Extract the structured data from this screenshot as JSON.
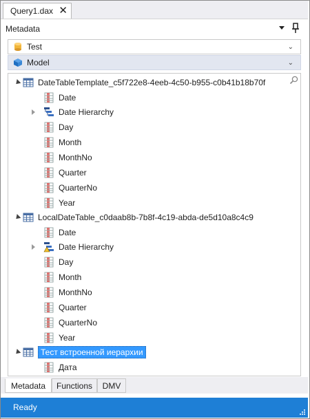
{
  "document_tab": {
    "title": "Query1.dax",
    "close_glyph": "✕"
  },
  "panel": {
    "title": "Metadata"
  },
  "database_combo": {
    "value": "Test",
    "icon": "database-icon"
  },
  "model_combo": {
    "value": "Model",
    "icon": "cube-icon"
  },
  "tree": {
    "tables": [
      {
        "name": "DateTableTemplate_c5f722e8-4eeb-4c50-b955-c0b41b18b70f",
        "expanded": true,
        "columns": [
          "Date",
          "Date Hierarchy",
          "Day",
          "Month",
          "MonthNo",
          "Quarter",
          "QuarterNo",
          "Year"
        ]
      },
      {
        "name": "LocalDateTable_c0daab8b-7b8f-4c19-abda-de5d10a8c4c9",
        "expanded": true,
        "columns": [
          "Date",
          "Date Hierarchy",
          "Day",
          "Month",
          "MonthNo",
          "Quarter",
          "QuarterNo",
          "Year"
        ]
      },
      {
        "name": "Тест встроенной иерархии",
        "expanded": true,
        "selected": true,
        "columns": [
          "Дата"
        ]
      }
    ]
  },
  "bottom_tabs": [
    "Metadata",
    "Functions",
    "DMV"
  ],
  "status": {
    "text": "Ready"
  },
  "colors": {
    "status_bar": "#1e7fd6",
    "selection": "#3399ff",
    "model_combo_bg": "#e2e6f0"
  }
}
